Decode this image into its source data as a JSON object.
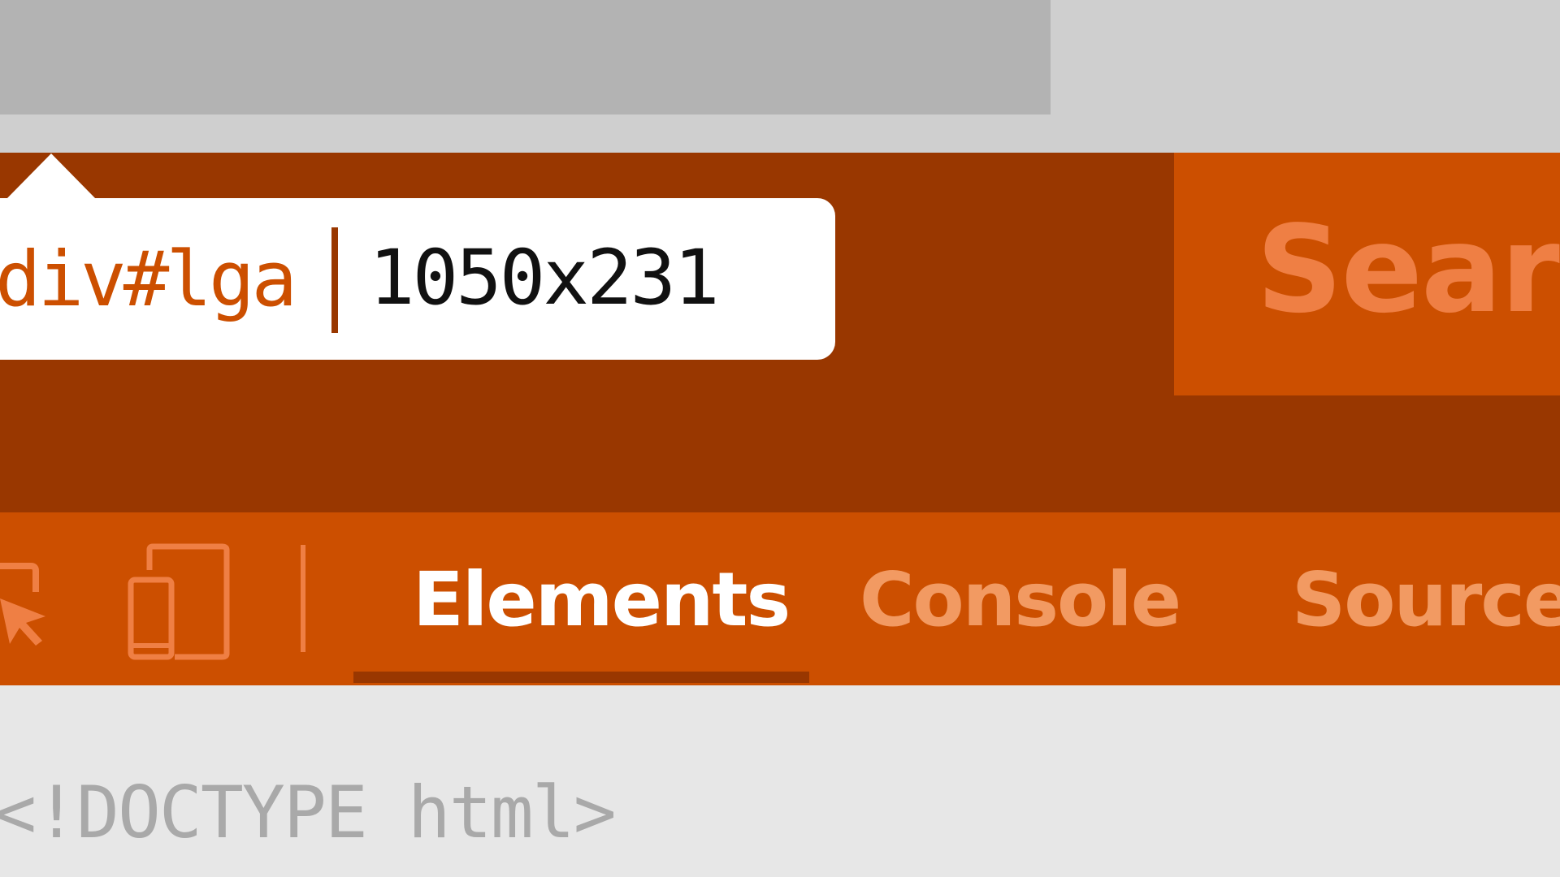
{
  "tooltip": {
    "selector": "div#lga",
    "dimensions": "1050x231"
  },
  "page": {
    "search_button_label": "Searc"
  },
  "devtools": {
    "tools": [
      {
        "icon": "inspect-element-icon"
      },
      {
        "icon": "device-toggle-icon"
      }
    ],
    "tabs": [
      {
        "label": "Elements",
        "active": true
      },
      {
        "label": "Console",
        "active": false
      },
      {
        "label": "Sources",
        "active": false
      }
    ]
  },
  "elements_panel": {
    "first_line": "<!DOCTYPE html>"
  },
  "colors": {
    "page_bg": "#993700",
    "accent": "#cc4f00",
    "light_accent": "#ef7f44",
    "active_tab_text": "#ffffff",
    "inactive_tab_text": "#f29a62",
    "panel_bg": "#e7e7e7"
  }
}
